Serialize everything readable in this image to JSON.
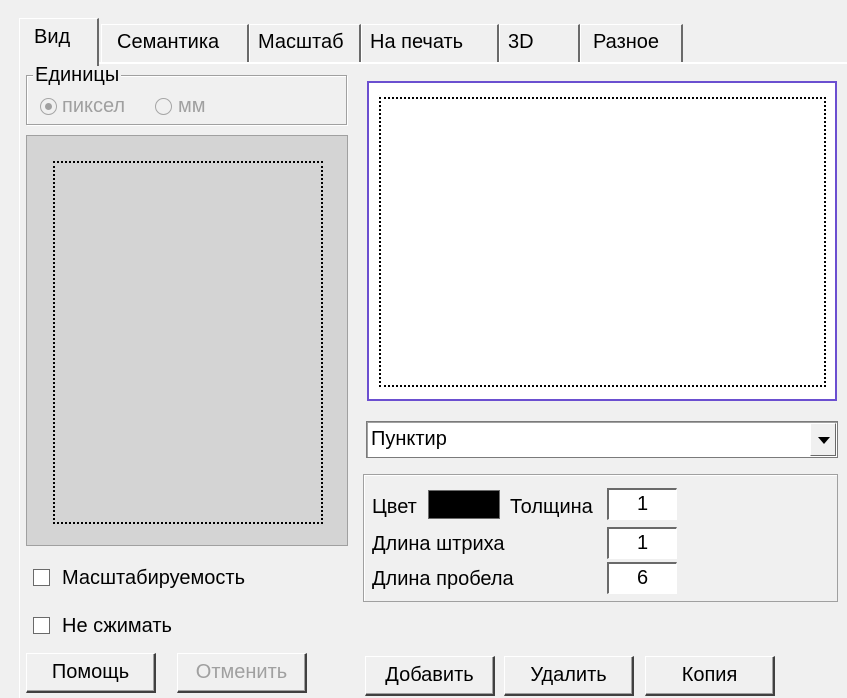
{
  "tabs": [
    {
      "label": "Вид",
      "active": true
    },
    {
      "label": "Семантика",
      "active": false
    },
    {
      "label": "Масштаб",
      "active": false
    },
    {
      "label": "На печать",
      "active": false
    },
    {
      "label": "3D",
      "active": false
    },
    {
      "label": "Разное",
      "active": false
    }
  ],
  "units": {
    "legend": "Единицы",
    "pixel_label": "пиксел",
    "mm_label": "мм",
    "selected": "пиксел"
  },
  "line_style": {
    "selected": "Пунктир"
  },
  "props": {
    "color_label": "Цвет",
    "color_value": "#000000",
    "thickness_label": "Толщина",
    "thickness_value": "1",
    "dash_length_label": "Длина штриха",
    "dash_length_value": "1",
    "gap_length_label": "Длина пробела",
    "gap_length_value": "6"
  },
  "options": {
    "scalable_label": "Масштабируемость",
    "no_compress_label": "Не сжимать"
  },
  "buttons": {
    "help": "Помощь",
    "cancel": "Отменить",
    "add": "Добавить",
    "delete": "Удалить",
    "copy": "Копия"
  },
  "colors": {
    "preview_border": "#6b4fd0",
    "window_bg": "#f0f0f0"
  }
}
